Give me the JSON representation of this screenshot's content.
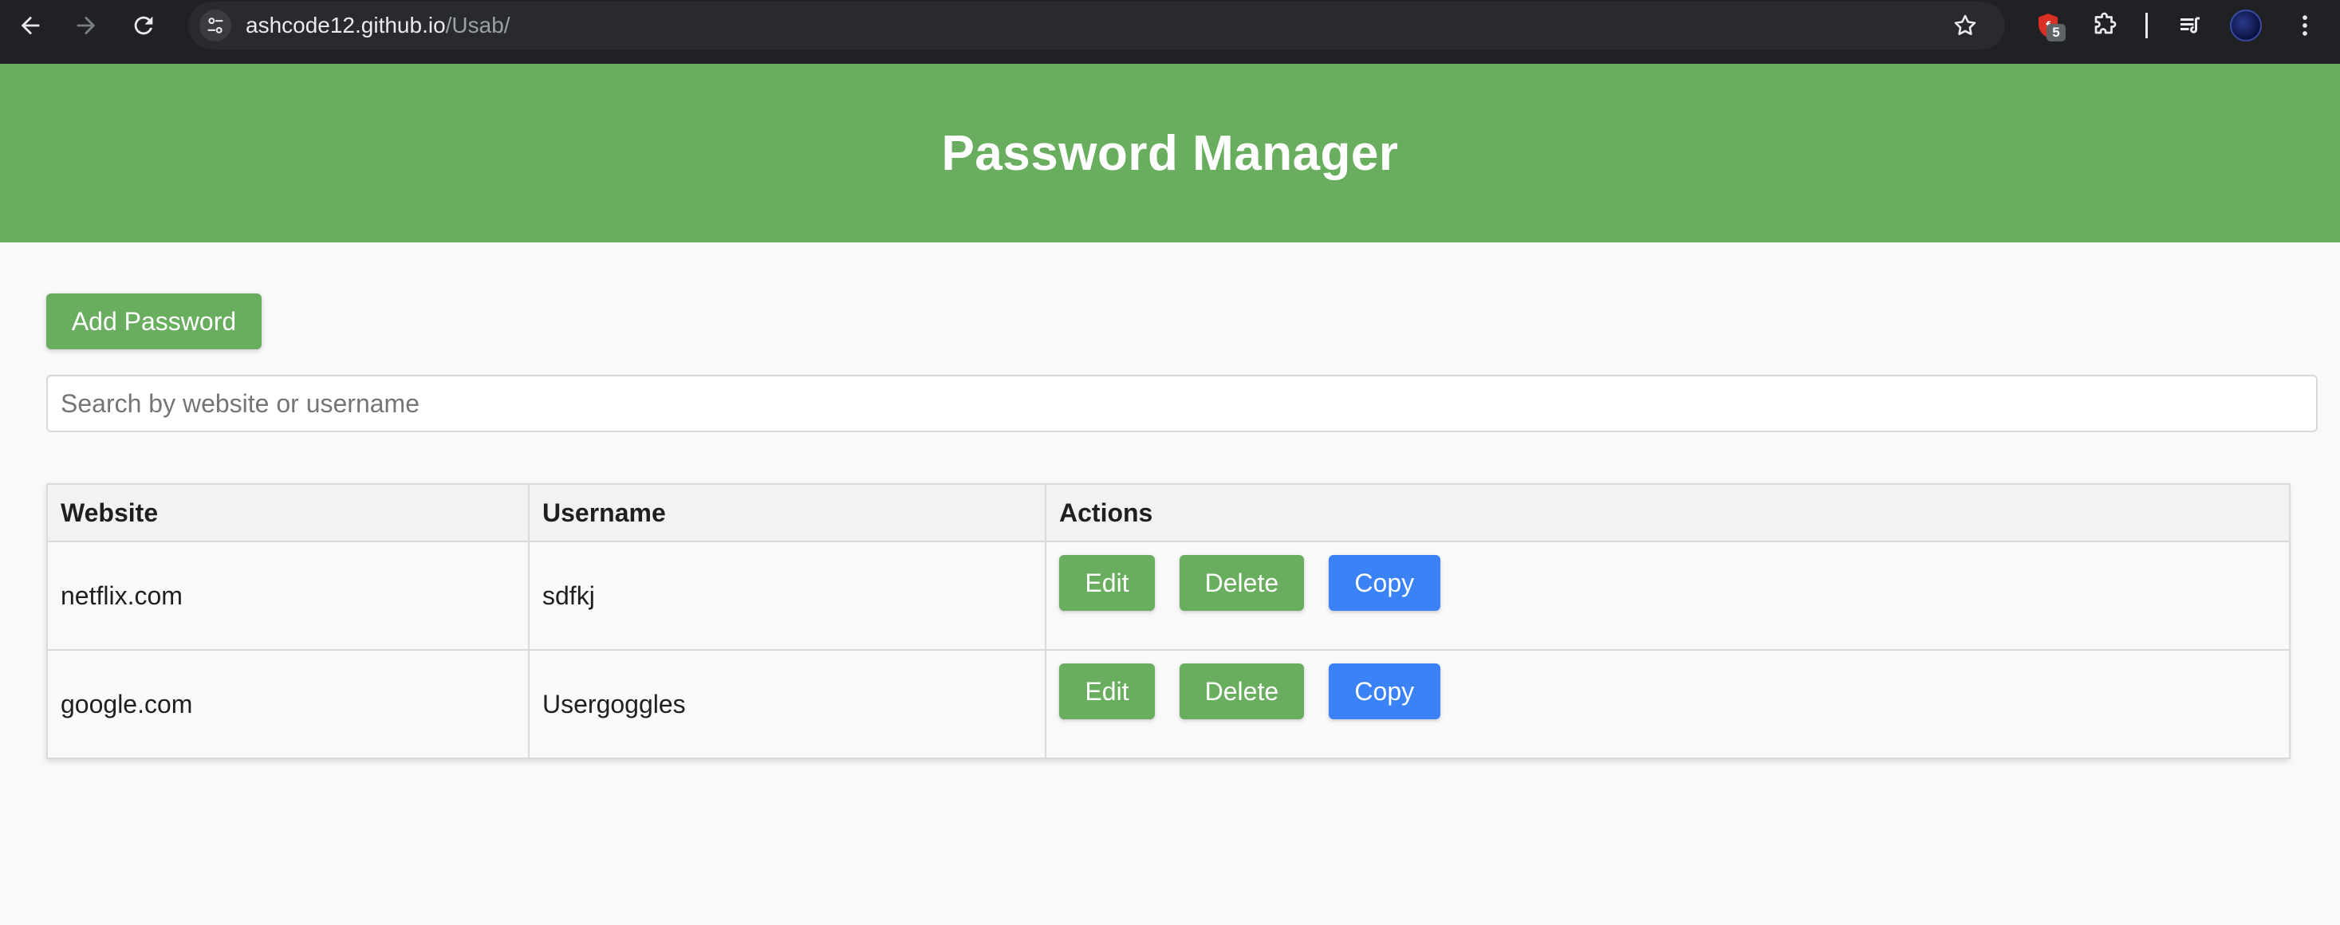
{
  "browser": {
    "url_host": "ashcode12.github.io",
    "url_path": "/Usab/",
    "extension_badge": "5"
  },
  "header": {
    "title": "Password Manager"
  },
  "toolbar": {
    "add_label": "Add Password"
  },
  "search": {
    "placeholder": "Search by website or username",
    "value": ""
  },
  "table": {
    "headers": [
      "Website",
      "Username",
      "Actions"
    ],
    "rows": [
      {
        "website": "netflix.com",
        "username": "sdfkj",
        "edit": "Edit",
        "delete": "Delete",
        "copy": "Copy"
      },
      {
        "website": "google.com",
        "username": "Usergoggles",
        "edit": "Edit",
        "delete": "Delete",
        "copy": "Copy"
      }
    ]
  },
  "colors": {
    "header_bg": "#69ae5e",
    "primary_button": "#69ae5e",
    "copy_button": "#3b82f6",
    "browser_chrome": "#202124"
  },
  "icons": [
    "back-arrow-icon",
    "forward-arrow-icon",
    "reload-icon",
    "site-settings-icon",
    "star-icon",
    "extension-shield-icon",
    "puzzle-icon",
    "media-queue-icon",
    "kebab-menu-icon"
  ]
}
